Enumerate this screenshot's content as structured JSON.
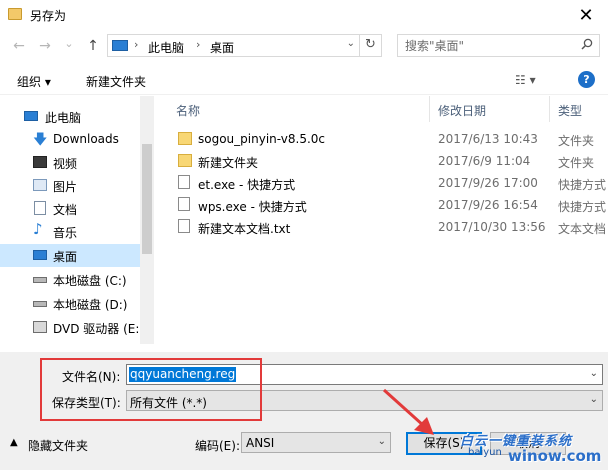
{
  "window": {
    "title": "另存为",
    "close_glyph": "✕"
  },
  "nav": {
    "back_glyph": "←",
    "forward_glyph": "→",
    "recent_glyph": "⌄",
    "up_glyph": "↑"
  },
  "address": {
    "crumbs": [
      "此电脑",
      "桌面"
    ],
    "sep": "›"
  },
  "search": {
    "placeholder": "搜索\"桌面\""
  },
  "toolbar": {
    "organize": "组织 ▾",
    "new_folder": "新建文件夹",
    "view": "☷ ▾",
    "help": "?"
  },
  "sidebar": {
    "items": [
      {
        "label": "此电脑",
        "icon": "computer-icon"
      },
      {
        "label": "Downloads",
        "icon": "download-icon"
      },
      {
        "label": "视频",
        "icon": "video-icon"
      },
      {
        "label": "图片",
        "icon": "picture-icon"
      },
      {
        "label": "文档",
        "icon": "document-icon"
      },
      {
        "label": "音乐",
        "icon": "music-icon"
      },
      {
        "label": "桌面",
        "icon": "desktop-icon",
        "selected": true
      },
      {
        "label": "本地磁盘 (C:)",
        "icon": "drive-icon"
      },
      {
        "label": "本地磁盘 (D:)",
        "icon": "drive-icon"
      },
      {
        "label": "DVD 驱动器 (E:)",
        "icon": "dvd-icon"
      }
    ]
  },
  "columns": {
    "name": "名称",
    "modified": "修改日期",
    "type": "类型"
  },
  "files": [
    {
      "name": "sogou_pinyin-v8.5.0c",
      "date": "2017/6/13 10:43",
      "type": "文件夹",
      "icon": "folder-icon"
    },
    {
      "name": "新建文件夹",
      "date": "2017/6/9 11:04",
      "type": "文件夹",
      "icon": "folder-icon"
    },
    {
      "name": "et.exe - 快捷方式",
      "date": "2017/9/26 17:00",
      "type": "快捷方式",
      "icon": "shortcut-icon"
    },
    {
      "name": "wps.exe - 快捷方式",
      "date": "2017/9/26 16:54",
      "type": "快捷方式",
      "icon": "shortcut-icon"
    },
    {
      "name": "新建文本文档.txt",
      "date": "2017/10/30 13:56",
      "type": "文本文档",
      "icon": "text-file-icon"
    }
  ],
  "form": {
    "filename_label": "文件名(N):",
    "filename_value": "qqyuancheng.reg",
    "type_label": "保存类型(T):",
    "type_value": "所有文件  (*.*)",
    "hide_folders": "隐藏文件夹",
    "encoding_label": "编码(E):",
    "encoding_value": "ANSI",
    "save": "保存(S)",
    "cancel": "取消"
  },
  "watermark": {
    "line1": "白云一键重装系统",
    "line2": "winow.com",
    "line3": "baiyun"
  },
  "accent_colors": {
    "selection": "#0078d7",
    "highlight": "#e23a3a",
    "sidebar_selected": "#cce8ff"
  }
}
